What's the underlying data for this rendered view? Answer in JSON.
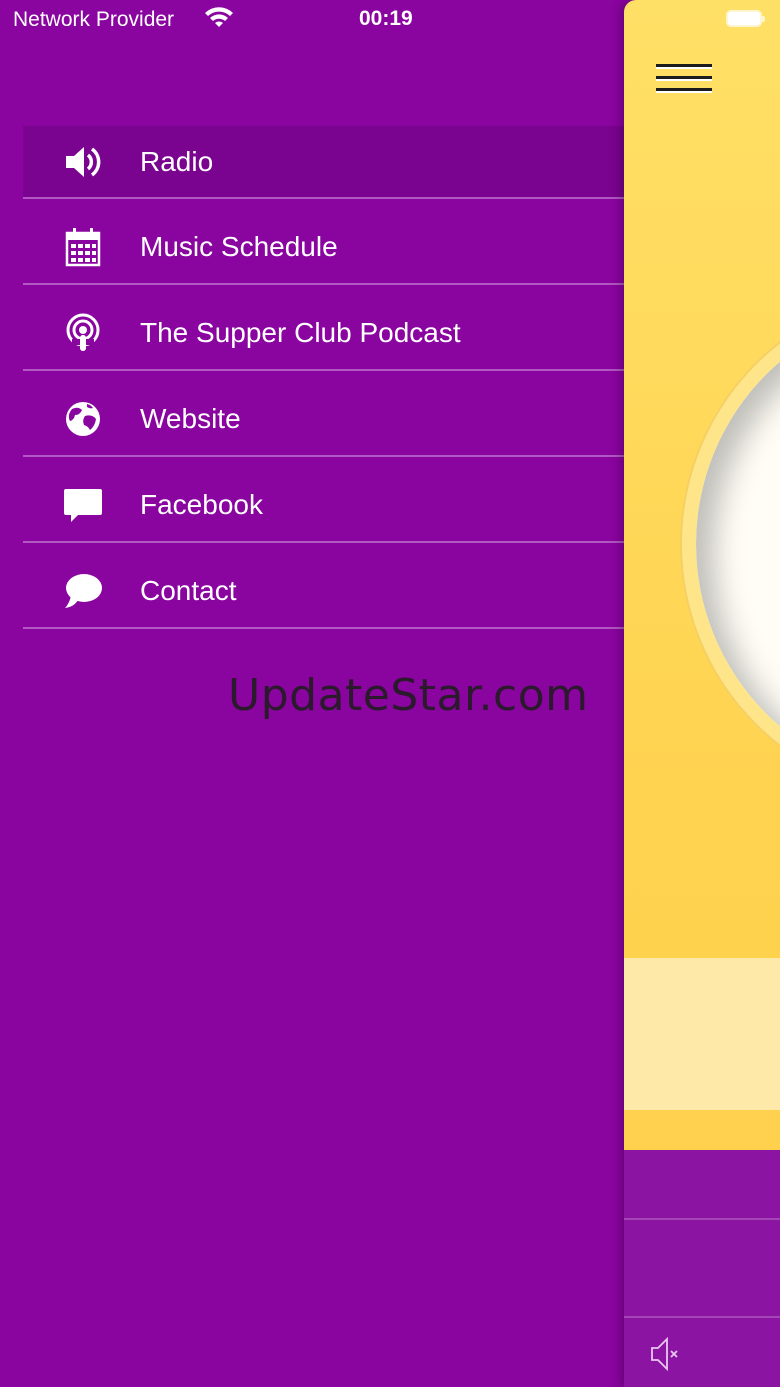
{
  "status_bar": {
    "carrier": "Network Provider",
    "time": "00:19"
  },
  "menu": {
    "items": [
      {
        "label": "Radio",
        "icon": "speaker-icon",
        "active": true
      },
      {
        "label": "Music Schedule",
        "icon": "calendar-icon",
        "active": false
      },
      {
        "label": "The Supper Club Podcast",
        "icon": "podcast-icon",
        "active": false
      },
      {
        "label": "Website",
        "icon": "globe-icon",
        "active": false
      },
      {
        "label": "Facebook",
        "icon": "chat-bubble-icon",
        "active": false
      },
      {
        "label": "Contact",
        "icon": "speech-bubble-icon",
        "active": false
      }
    ]
  },
  "watermark": "UpdateStar.com",
  "colors": {
    "drawer_bg": "#8a04a0",
    "active_item_bg": "#7a038f",
    "main_panel_bg": "#ffd857",
    "controls_bg": "#8c14a2"
  }
}
